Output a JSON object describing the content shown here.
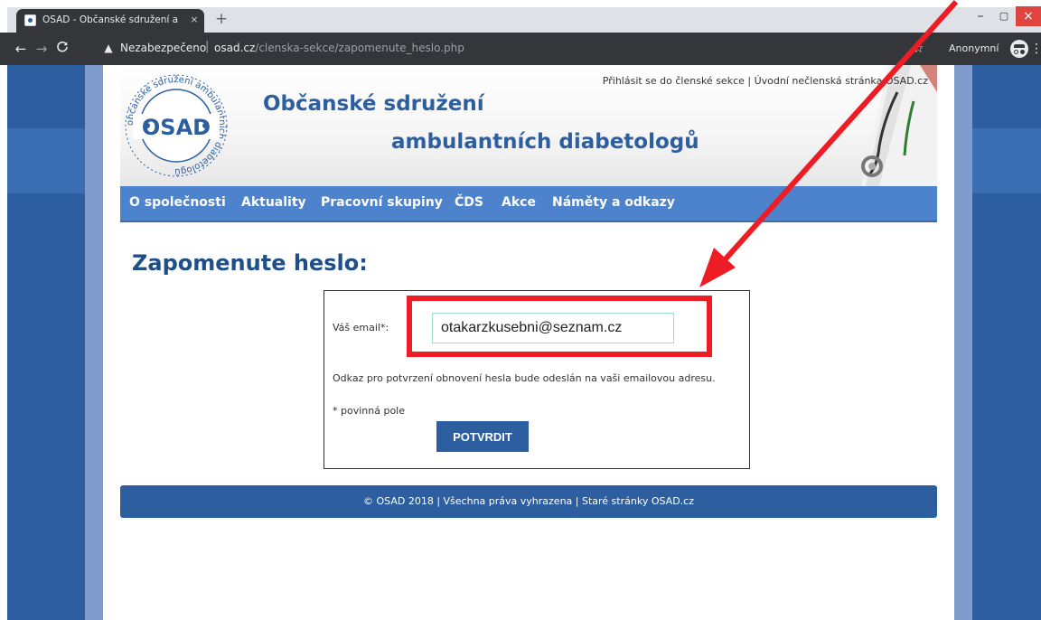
{
  "browser": {
    "tab_title": "OSAD - Občanské sdružení ambu",
    "tab_close": "×",
    "new_tab": "+",
    "window_min": "–",
    "window_max": "▢",
    "window_close": "×",
    "back": "←",
    "forward": "→",
    "reload": "C",
    "security_label": "Nezabezpečeno",
    "url_domain": "osad.cz",
    "url_path": "/clenska-sekce/zapomenute_heslo.php",
    "profile_label": "Anonymní",
    "menu": "⋮",
    "icons": [
      "osad-favicon",
      "warning-icon",
      "star-icon",
      "incognito-icon"
    ]
  },
  "header": {
    "title_line1": "Občanské sdružení",
    "title_line2": "ambulantních diabetologů",
    "login_link": "Přihlásit se do členské sekce",
    "link_separator": "|",
    "home_link": "Úvodní nečlenská stránka OSAD.cz",
    "logo": {
      "abbr": "OSAD",
      "ring_text": "občanské sdružení ambulantních diabetologů"
    }
  },
  "nav": {
    "items": [
      "O společnosti",
      "Aktuality",
      "Pracovní skupiny",
      "ČDS",
      "Akce",
      "Náměty a odkazy"
    ]
  },
  "page": {
    "title": "Zapomenute heslo:"
  },
  "form": {
    "email_label": "Váš email*:",
    "email_value": "otakarzkusebni@seznam.cz",
    "info": "Odkaz pro potvrzení obnovení hesla bude odeslán na vaši emailovou adresu.",
    "required_note": "* povinná pole",
    "submit_label": "POTVRDIT"
  },
  "footer": {
    "text": "© OSAD 2018 | Všechna práva vyhrazena | Staré stránky OSAD.cz"
  },
  "colors": {
    "brand_blue": "#2d5fa0",
    "nav_blue": "#4d82cc",
    "annotation_red": "#ee1c24"
  }
}
